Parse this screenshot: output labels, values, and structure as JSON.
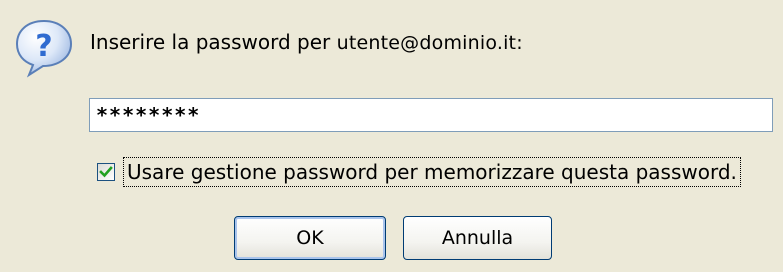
{
  "dialog": {
    "prompt_text": "Inserire la password per ",
    "account": "utente@dominio.it:",
    "password_value": "********",
    "remember_label": "Usare gestione password per memorizzare questa password.",
    "remember_checked": true,
    "ok_label": "OK",
    "cancel_label": "Annulla",
    "icon": "question-icon"
  },
  "colors": {
    "background": "#ece9d8",
    "field_border": "#7f9db9",
    "button_border": "#003c74",
    "checkmark": "#21a121",
    "icon_blue": "#3a78d6"
  }
}
